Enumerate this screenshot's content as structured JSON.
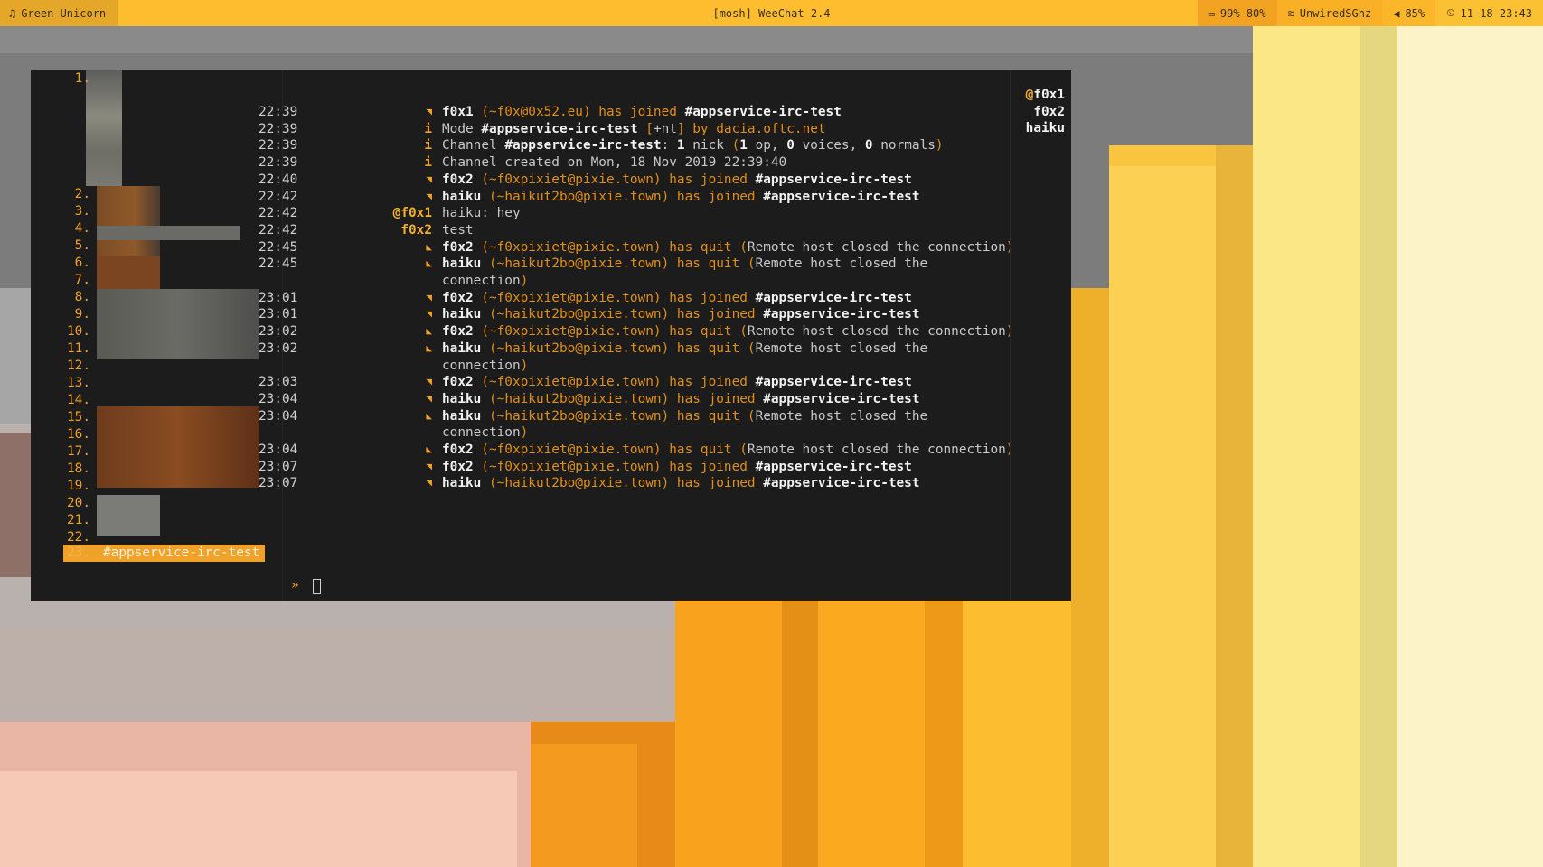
{
  "topbar": {
    "left_icon": "music-note-icon",
    "left_label": "Green Unicorn",
    "center_title": "[mosh] WeeChat 2.4",
    "battery_icon": "battery-icon",
    "battery": "99% 80%",
    "wifi_icon": "wifi-icon",
    "wifi": "UnwiredSGhz",
    "volume_icon": "speaker-icon",
    "volume": "85%",
    "clock_icon": "clock-icon",
    "datetime": "11-18 23:43"
  },
  "buflist": {
    "numbers": [
      "1.",
      "2.",
      "3.",
      "4.",
      "5.",
      "6.",
      "7.",
      "8.",
      "9.",
      "10.",
      "11.",
      "12.",
      "13.",
      "14.",
      "15.",
      "16.",
      "17.",
      "18.",
      "19.",
      "20.",
      "21.",
      "22."
    ],
    "active_number": "23.",
    "active_name": "#appservice-irc-test"
  },
  "chat": {
    "lines": [
      {
        "time": "22:39",
        "prefix": "◥",
        "segs": [
          {
            "t": "f0x1",
            "c": "b"
          },
          {
            "t": " (",
            "c": "o"
          },
          {
            "t": "~f0x@0x52.eu",
            "c": "o"
          },
          {
            "t": ") has joined ",
            "c": "o"
          },
          {
            "t": "#appservice-irc-test",
            "c": "b"
          }
        ]
      },
      {
        "time": "22:39",
        "prefix": "i",
        "segs": [
          {
            "t": "Mode ",
            "c": ""
          },
          {
            "t": "#appservice-irc-test",
            "c": "b"
          },
          {
            "t": " [",
            "c": "o"
          },
          {
            "t": "+nt",
            "c": ""
          },
          {
            "t": "] by ",
            "c": "o"
          },
          {
            "t": "dacia.oftc.net",
            "c": "o"
          }
        ]
      },
      {
        "time": "22:39",
        "prefix": "i",
        "segs": [
          {
            "t": "Channel ",
            "c": ""
          },
          {
            "t": "#appservice-irc-test",
            "c": "b"
          },
          {
            "t": ": ",
            "c": ""
          },
          {
            "t": "1",
            "c": "b"
          },
          {
            "t": " nick ",
            "c": ""
          },
          {
            "t": "(",
            "c": "o"
          },
          {
            "t": "1",
            "c": "b"
          },
          {
            "t": " op, ",
            "c": ""
          },
          {
            "t": "0",
            "c": "b"
          },
          {
            "t": " voices, ",
            "c": ""
          },
          {
            "t": "0",
            "c": "b"
          },
          {
            "t": " normals",
            "c": ""
          },
          {
            "t": ")",
            "c": "o"
          }
        ]
      },
      {
        "time": "22:39",
        "prefix": "i",
        "segs": [
          {
            "t": "Channel created on Mon, 18 Nov 2019 22:39:40",
            "c": ""
          }
        ]
      },
      {
        "time": "22:40",
        "prefix": "◥",
        "segs": [
          {
            "t": "f0x2",
            "c": "b"
          },
          {
            "t": " (~f0xpixiet@pixie.town) has joined ",
            "c": "o"
          },
          {
            "t": "#appservice-irc-test",
            "c": "b"
          }
        ]
      },
      {
        "time": "22:42",
        "prefix": "◥",
        "segs": [
          {
            "t": "haiku",
            "c": "b"
          },
          {
            "t": " (~haikut2bo@pixie.town) has joined ",
            "c": "o"
          },
          {
            "t": "#appservice-irc-test",
            "c": "b"
          }
        ]
      },
      {
        "time": "22:42",
        "prefix": "@f0x1",
        "prefixcls": "nick1",
        "segs": [
          {
            "t": "haiku: hey",
            "c": ""
          }
        ]
      },
      {
        "time": "22:42",
        "prefix": "f0x2",
        "prefixcls": "nick2",
        "segs": [
          {
            "t": "test",
            "c": ""
          }
        ]
      },
      {
        "time": "22:45",
        "prefix": "◣",
        "segs": [
          {
            "t": "f0x2",
            "c": "b"
          },
          {
            "t": " (~f0xpixiet@pixie.town) has quit (",
            "c": "o"
          },
          {
            "t": "Remote host closed the connection",
            "c": ""
          },
          {
            "t": ")",
            "c": "o"
          }
        ]
      },
      {
        "time": "22:45",
        "prefix": "◣",
        "segs": [
          {
            "t": "haiku",
            "c": "b"
          },
          {
            "t": " (~haikut2bo@pixie.town) has quit (",
            "c": "o"
          },
          {
            "t": "Remote host closed the",
            "c": ""
          }
        ]
      },
      {
        "time": "",
        "prefix": "",
        "segs": [
          {
            "t": "connection",
            "c": ""
          },
          {
            "t": ")",
            "c": "o"
          }
        ]
      },
      {
        "time": "23:01",
        "prefix": "◥",
        "segs": [
          {
            "t": "f0x2",
            "c": "b"
          },
          {
            "t": " (~f0xpixiet@pixie.town) has joined ",
            "c": "o"
          },
          {
            "t": "#appservice-irc-test",
            "c": "b"
          }
        ]
      },
      {
        "time": "23:01",
        "prefix": "◥",
        "segs": [
          {
            "t": "haiku",
            "c": "b"
          },
          {
            "t": " (~haikut2bo@pixie.town) has joined ",
            "c": "o"
          },
          {
            "t": "#appservice-irc-test",
            "c": "b"
          }
        ]
      },
      {
        "time": "23:02",
        "prefix": "◣",
        "segs": [
          {
            "t": "f0x2",
            "c": "b"
          },
          {
            "t": " (~f0xpixiet@pixie.town) has quit (",
            "c": "o"
          },
          {
            "t": "Remote host closed the connection",
            "c": ""
          },
          {
            "t": ")",
            "c": "o"
          }
        ]
      },
      {
        "time": "23:02",
        "prefix": "◣",
        "segs": [
          {
            "t": "haiku",
            "c": "b"
          },
          {
            "t": " (~haikut2bo@pixie.town) has quit (",
            "c": "o"
          },
          {
            "t": "Remote host closed the",
            "c": ""
          }
        ]
      },
      {
        "time": "",
        "prefix": "",
        "segs": [
          {
            "t": "connection",
            "c": ""
          },
          {
            "t": ")",
            "c": "o"
          }
        ]
      },
      {
        "time": "23:03",
        "prefix": "◥",
        "segs": [
          {
            "t": "f0x2",
            "c": "b"
          },
          {
            "t": " (~f0xpixiet@pixie.town) has joined ",
            "c": "o"
          },
          {
            "t": "#appservice-irc-test",
            "c": "b"
          }
        ]
      },
      {
        "time": "23:04",
        "prefix": "◥",
        "segs": [
          {
            "t": "haiku",
            "c": "b"
          },
          {
            "t": " (~haikut2bo@pixie.town) has joined ",
            "c": "o"
          },
          {
            "t": "#appservice-irc-test",
            "c": "b"
          }
        ]
      },
      {
        "time": "23:04",
        "prefix": "◣",
        "segs": [
          {
            "t": "haiku",
            "c": "b"
          },
          {
            "t": " (~haikut2bo@pixie.town) has quit (",
            "c": "o"
          },
          {
            "t": "Remote host closed the",
            "c": ""
          }
        ]
      },
      {
        "time": "",
        "prefix": "",
        "segs": [
          {
            "t": "connection",
            "c": ""
          },
          {
            "t": ")",
            "c": "o"
          }
        ]
      },
      {
        "time": "23:04",
        "prefix": "◣",
        "segs": [
          {
            "t": "f0x2",
            "c": "b"
          },
          {
            "t": " (~f0xpixiet@pixie.town) has quit (",
            "c": "o"
          },
          {
            "t": "Remote host closed the connection",
            "c": ""
          },
          {
            "t": ")",
            "c": "o"
          }
        ]
      },
      {
        "time": "23:07",
        "prefix": "◥",
        "segs": [
          {
            "t": "f0x2",
            "c": "b"
          },
          {
            "t": " (~f0xpixiet@pixie.town) has joined ",
            "c": "o"
          },
          {
            "t": "#appservice-irc-test",
            "c": "b"
          }
        ]
      },
      {
        "time": "23:07",
        "prefix": "◥",
        "segs": [
          {
            "t": "haiku",
            "c": "b"
          },
          {
            "t": " (~haikut2bo@pixie.town) has joined ",
            "c": "o"
          },
          {
            "t": "#appservice-irc-test",
            "c": "b"
          }
        ]
      }
    ]
  },
  "nicklist": {
    "nicks": [
      {
        "mode": "@",
        "name": "f0x1"
      },
      {
        "mode": "",
        "name": "f0x2"
      },
      {
        "mode": "",
        "name": "haiku"
      }
    ]
  },
  "input": {
    "prompt": "»"
  },
  "colors": {
    "accent": "#f0a12a",
    "topbar": "#fdbd2e",
    "terminal_bg": "#1c1c1c"
  }
}
